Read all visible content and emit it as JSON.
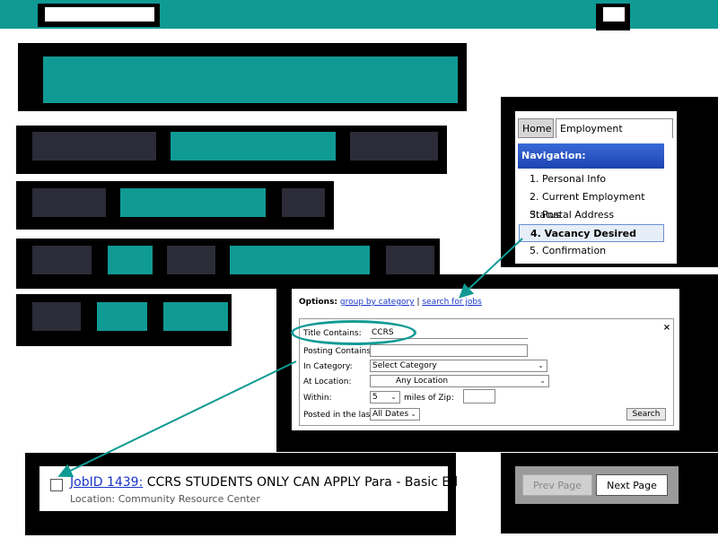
{
  "colors": {
    "accent": "#109a94",
    "dark_block": "#2c2c38",
    "nav_header": "#2a58c8"
  },
  "nav": {
    "tabs": [
      "Home",
      "Employment Application"
    ],
    "header": "Navigation:",
    "items": [
      "1. Personal Info",
      "2. Current Employment Status",
      "3. Postal Address",
      "4. Vacancy Desired",
      "5. Confirmation"
    ],
    "active_index": 3
  },
  "search": {
    "options_label": "Options:",
    "option_links": [
      "group by category",
      "search for jobs"
    ],
    "separator": "|",
    "fields": {
      "title_contains": {
        "label": "Title Contains:",
        "value": "CCRS"
      },
      "posting_contains": {
        "label": "Posting Contains:",
        "value": ""
      },
      "in_category": {
        "label": "In Category:",
        "value": "Select Category"
      },
      "at_location": {
        "label": "At Location:",
        "value": "Any Location"
      },
      "within": {
        "label": "Within:",
        "value": "5",
        "suffix": "miles of Zip:"
      },
      "posted_in_last": {
        "label": "Posted in the last:",
        "value": "All Dates"
      }
    },
    "close_label": "×",
    "search_button": "Search"
  },
  "job": {
    "id_text": "JobID 1439:",
    "title": "CCRS STUDENTS ONLY CAN APPLY Para - Basic Ed",
    "location": "Location: Community Resource Center"
  },
  "pager": {
    "prev": "Prev Page",
    "next": "Next Page"
  }
}
